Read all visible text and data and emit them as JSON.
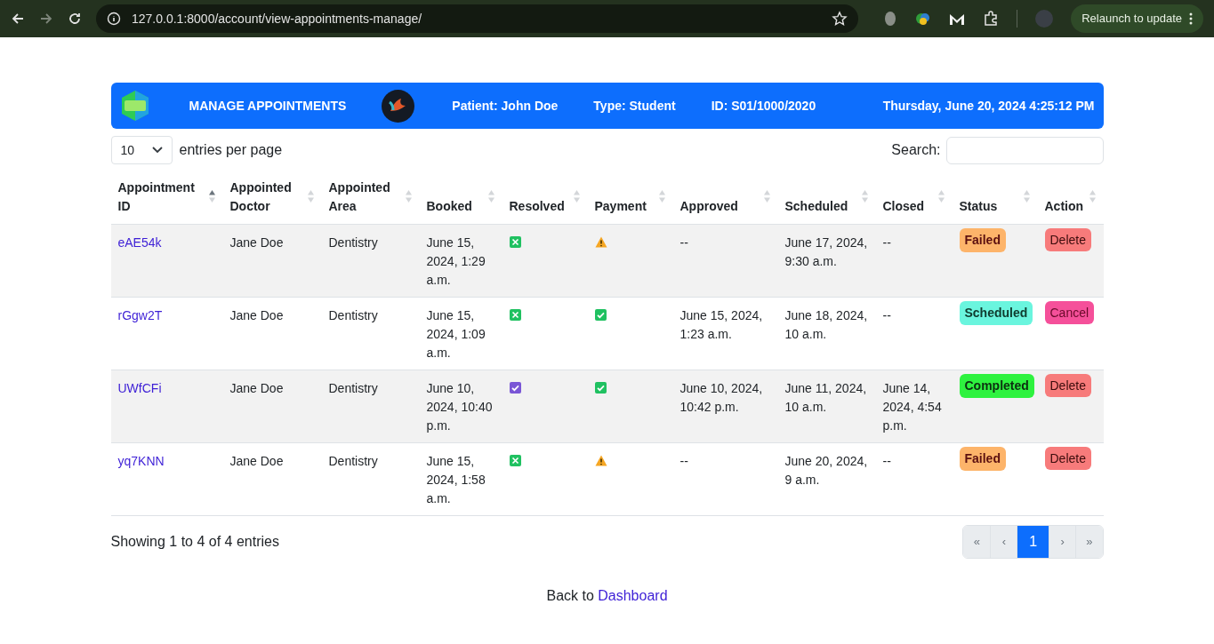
{
  "browser": {
    "url": "127.0.0.1:8000/account/view-appointments-manage/",
    "update_button": "Relaunch to update"
  },
  "header": {
    "title": "MANAGE APPOINTMENTS",
    "patient": "Patient: John Doe",
    "type": "Type: Student",
    "id": "ID: S01/1000/2020",
    "datetime": "Thursday, June 20, 2024 4:25:12 PM"
  },
  "entries": {
    "value": "10",
    "label": "entries per page"
  },
  "search": {
    "label": "Search:"
  },
  "table": {
    "columns": [
      {
        "label": "Appointment ID",
        "sorted": true
      },
      {
        "label": "Appointed Doctor",
        "sorted": false
      },
      {
        "label": "Appointed Area",
        "sorted": false
      },
      {
        "label": "Booked",
        "sorted": false
      },
      {
        "label": "Resolved",
        "sorted": false
      },
      {
        "label": "Payment",
        "sorted": false
      },
      {
        "label": "Approved",
        "sorted": false
      },
      {
        "label": "Scheduled",
        "sorted": false
      },
      {
        "label": "Closed",
        "sorted": false
      },
      {
        "label": "Status",
        "sorted": false
      },
      {
        "label": "Action",
        "sorted": false
      }
    ],
    "rows": [
      {
        "id": "eAE54k",
        "doctor": "Jane Doe",
        "area": "Dentistry",
        "booked": "June 15, 2024, 1:29 a.m.",
        "resolved": false,
        "paid": false,
        "approved": "--",
        "scheduled": "June 17, 2024, 9:30 a.m.",
        "closed": "--",
        "status": {
          "kind": "failed",
          "label": "Failed"
        },
        "action": {
          "kind": "delete",
          "label": "Delete"
        }
      },
      {
        "id": "rGgw2T",
        "doctor": "Jane Doe",
        "area": "Dentistry",
        "booked": "June 15, 2024, 1:09 a.m.",
        "resolved": false,
        "paid": true,
        "approved": "June 15, 2024, 1:23 a.m.",
        "scheduled": "June 18, 2024, 10 a.m.",
        "closed": "--",
        "status": {
          "kind": "scheduled",
          "label": "Scheduled"
        },
        "action": {
          "kind": "cancel",
          "label": "Cancel"
        }
      },
      {
        "id": "UWfCFi",
        "doctor": "Jane Doe",
        "area": "Dentistry",
        "booked": "June 10, 2024, 10:40 p.m.",
        "resolved": true,
        "paid": true,
        "approved": "June 10, 2024, 10:42 p.m.",
        "scheduled": "June 11, 2024, 10 a.m.",
        "closed": "June 14, 2024, 4:54 p.m.",
        "status": {
          "kind": "completed",
          "label": "Completed"
        },
        "action": {
          "kind": "delete",
          "label": "Delete"
        }
      },
      {
        "id": "yq7KNN",
        "doctor": "Jane Doe",
        "area": "Dentistry",
        "booked": "June 15, 2024, 1:58 a.m.",
        "resolved": false,
        "paid": false,
        "approved": "--",
        "scheduled": "June 20, 2024, 9 a.m.",
        "closed": "--",
        "status": {
          "kind": "failed",
          "label": "Failed"
        },
        "action": {
          "kind": "delete",
          "label": "Delete"
        }
      }
    ]
  },
  "summary": "Showing 1 to 4 of 4 entries",
  "pagination": [
    {
      "label": "«",
      "selected": false
    },
    {
      "label": "‹",
      "selected": false
    },
    {
      "label": "1",
      "selected": true
    },
    {
      "label": "›",
      "selected": false
    },
    {
      "label": "»",
      "selected": false
    }
  ],
  "footer": {
    "text": "Back to",
    "link": "Dashboard"
  }
}
